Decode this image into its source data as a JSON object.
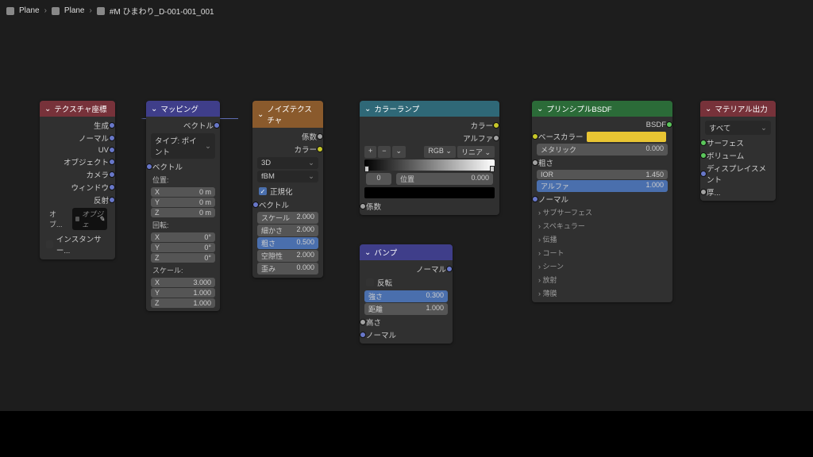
{
  "breadcrumb": {
    "a": "Plane",
    "b": "Plane",
    "c": "#M ひまわり_D-001-001_001"
  },
  "texcoord": {
    "title": "テクスチャ座標",
    "outs": [
      "生成",
      "ノーマル",
      "UV",
      "オブジェクト",
      "カメラ",
      "ウィンドウ",
      "反射"
    ],
    "obj_lbl": "オブ...",
    "obj_ph": "オブジェ",
    "inst": "インスタンサー..."
  },
  "mapping": {
    "title": "マッピング",
    "out": "ベクトル",
    "type_lbl": "タイプ:",
    "type_val": "ポイント",
    "in_vec": "ベクトル",
    "loc": "位置:",
    "rot": "回転:",
    "scl": "スケール:",
    "loc_x": "0 m",
    "loc_y": "0 m",
    "loc_z": "0 m",
    "rot_x": "0°",
    "rot_y": "0°",
    "rot_z": "0°",
    "scl_x": "3.000",
    "scl_y": "1.000",
    "scl_z": "1.000",
    "x": "X",
    "y": "Y",
    "z": "Z"
  },
  "noise": {
    "title": "ノイズテクスチャ",
    "o_fac": "係数",
    "o_col": "カラー",
    "dim": "3D",
    "mode": "fBM",
    "norm": "正規化",
    "in_vec": "ベクトル",
    "scale_l": "スケール",
    "scale_v": "2.000",
    "det_l": "細かさ",
    "det_v": "2.000",
    "rough_l": "粗さ",
    "rough_v": "0.500",
    "lac_l": "空隙性",
    "lac_v": "2.000",
    "dist_l": "歪み",
    "dist_v": "0.000"
  },
  "ramp": {
    "title": "カラーランプ",
    "o_col": "カラー",
    "o_alpha": "アルファ",
    "mode": "RGB",
    "interp": "リニア",
    "pos_l": "位置",
    "pos_v": "0.000",
    "idx": "0",
    "in_fac": "係数"
  },
  "bump": {
    "title": "バンプ",
    "o_nrm": "ノーマル",
    "invert": "反転",
    "str_l": "強さ",
    "str_v": "0.300",
    "dist_l": "距離",
    "dist_v": "1.000",
    "height": "高さ",
    "normal": "ノーマル"
  },
  "bsdf": {
    "title": "プリンシプルBSDF",
    "out": "BSDF",
    "base_l": "ベースカラー",
    "met_l": "メタリック",
    "met_v": "0.000",
    "rough": "粗さ",
    "ior_l": "IOR",
    "ior_v": "1.450",
    "alpha_l": "アルファ",
    "alpha_v": "1.000",
    "normal": "ノーマル",
    "secs": [
      "サブサーフェス",
      "スペキュラー",
      "伝播",
      "コート",
      "シーン",
      "放射",
      "薄膜"
    ]
  },
  "output": {
    "title": "マテリアル出力",
    "target": "すべて",
    "surf": "サーフェス",
    "vol": "ボリューム",
    "disp": "ディスプレイスメント",
    "thick": "厚..."
  }
}
